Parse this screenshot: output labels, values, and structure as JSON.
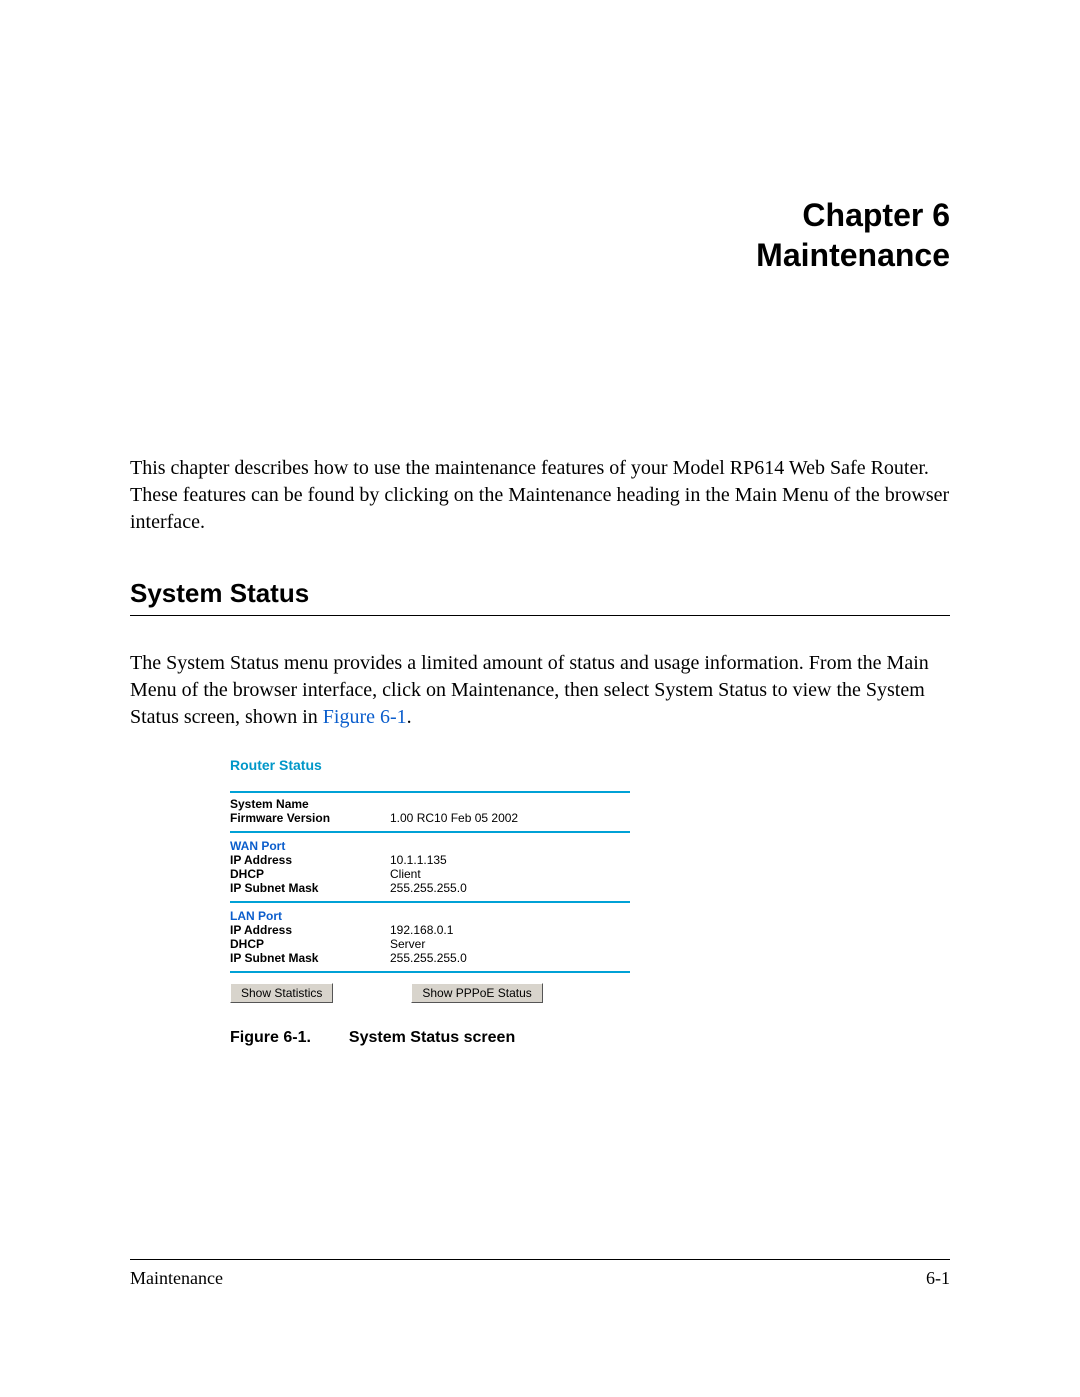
{
  "header": {
    "chapter_line": "Chapter 6",
    "title_line": "Maintenance"
  },
  "intro": "This chapter describes how to use the maintenance features of your Model RP614 Web Safe Router. These features can be found by clicking on the Maintenance heading in the Main Menu of the browser interface.",
  "section": {
    "title": "System Status",
    "body_pre": "The System Status menu provides a limited amount of status and usage information. From the Main Menu of the browser interface, click on Maintenance, then select System Status to view the System Status screen, shown in ",
    "body_link": "Figure 6-1",
    "body_post": "."
  },
  "router_status": {
    "panel_title": "Router Status",
    "system_name_label": "System Name",
    "system_name_value": "",
    "firmware_label": "Firmware Version",
    "firmware_value": "1.00 RC10 Feb 05 2002",
    "wan": {
      "header": "WAN Port",
      "ip_label": "IP Address",
      "ip_value": "10.1.1.135",
      "dhcp_label": "DHCP",
      "dhcp_value": "Client",
      "mask_label": "IP Subnet Mask",
      "mask_value": "255.255.255.0"
    },
    "lan": {
      "header": "LAN Port",
      "ip_label": "IP Address",
      "ip_value": "192.168.0.1",
      "dhcp_label": "DHCP",
      "dhcp_value": "Server",
      "mask_label": "IP Subnet Mask",
      "mask_value": "255.255.255.0"
    },
    "buttons": {
      "stats": "Show Statistics",
      "pppoe": "Show PPPoE Status"
    }
  },
  "caption": {
    "num": "Figure 6-1.",
    "text": "System Status screen"
  },
  "footer": {
    "left": "Maintenance",
    "right": "6-1"
  }
}
